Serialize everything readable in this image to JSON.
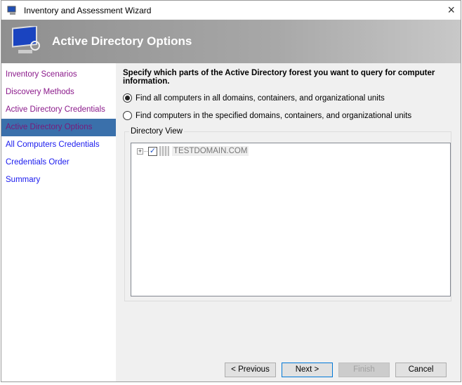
{
  "window": {
    "title": "Inventory and Assessment Wizard"
  },
  "banner": {
    "title": "Active Directory Options"
  },
  "nav": {
    "items": [
      {
        "label": "Inventory Scenarios",
        "state": "visited"
      },
      {
        "label": "Discovery Methods",
        "state": "visited"
      },
      {
        "label": "Active Directory Credentials",
        "state": "visited"
      },
      {
        "label": "Active Directory Options",
        "state": "selected"
      },
      {
        "label": "All Computers Credentials",
        "state": "unvisited"
      },
      {
        "label": "Credentials Order",
        "state": "unvisited"
      },
      {
        "label": "Summary",
        "state": "unvisited"
      }
    ]
  },
  "main": {
    "question": "Specify which parts of the Active Directory forest you want to query for computer information.",
    "options": [
      {
        "label": "Find all computers in all domains, containers, and organizational units",
        "selected": true
      },
      {
        "label": "Find computers in the specified domains, containers, and organizational units",
        "selected": false
      }
    ],
    "directory_view": {
      "label": "Directory View",
      "nodes": [
        {
          "label": "TESTDOMAIN.COM",
          "checked": true,
          "expander": "+"
        }
      ]
    }
  },
  "buttons": {
    "previous": "< Previous",
    "next": "Next >",
    "finish": "Finish",
    "cancel": "Cancel"
  },
  "icons": {
    "close": "×",
    "check": "✓"
  }
}
